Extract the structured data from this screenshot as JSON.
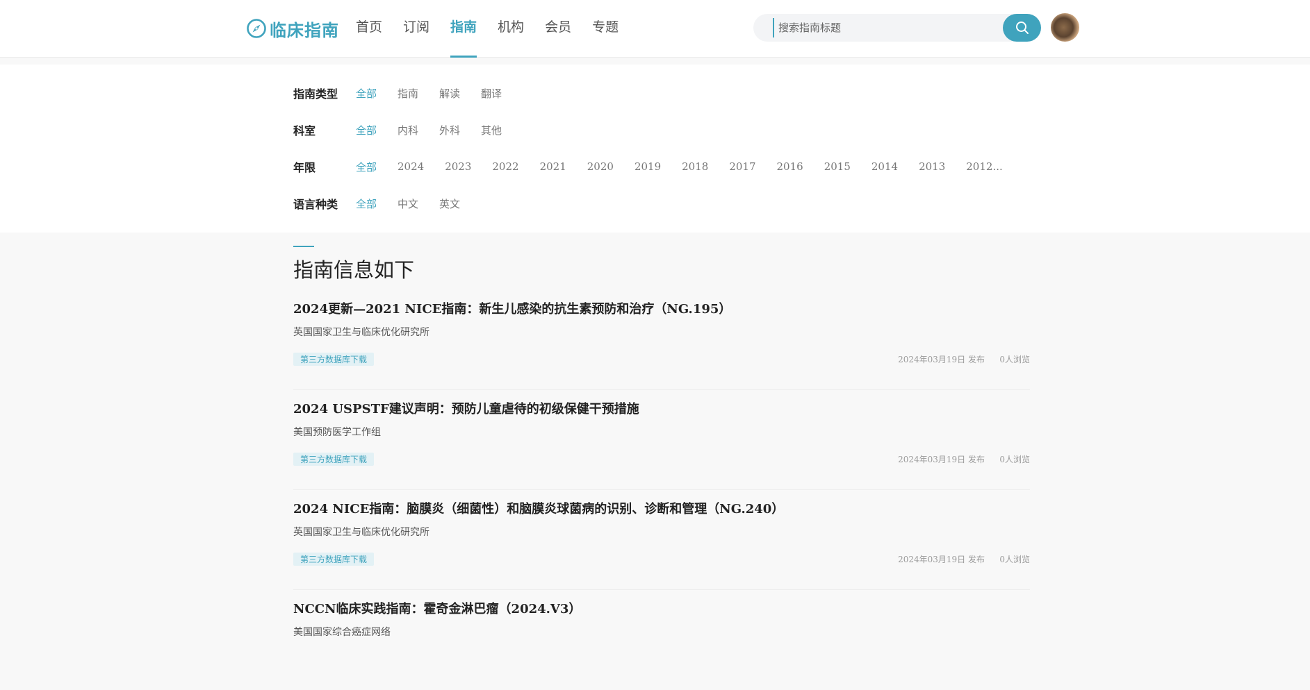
{
  "header": {
    "logo_text": "临床指南",
    "nav": [
      {
        "label": "首页",
        "active": false
      },
      {
        "label": "订阅",
        "active": false
      },
      {
        "label": "指南",
        "active": true
      },
      {
        "label": "机构",
        "active": false
      },
      {
        "label": "会员",
        "active": false
      },
      {
        "label": "专题",
        "active": false
      }
    ],
    "search": {
      "placeholder": "搜索指南标题"
    },
    "accent_color": "#3fa3bd"
  },
  "filters": [
    {
      "label": "指南类型",
      "options": [
        "全部",
        "指南",
        "解读",
        "翻译"
      ],
      "active": 0
    },
    {
      "label": "科室",
      "options": [
        "全部",
        "内科",
        "外科",
        "其他"
      ],
      "active": 0
    },
    {
      "label": "年限",
      "options": [
        "全部",
        "2024",
        "2023",
        "2022",
        "2021",
        "2020",
        "2019",
        "2018",
        "2017",
        "2016",
        "2015",
        "2014",
        "2013",
        "2012..."
      ],
      "active": 0
    },
    {
      "label": "语言种类",
      "options": [
        "全部",
        "中文",
        "英文"
      ],
      "active": 0
    }
  ],
  "list": {
    "title": "指南信息如下",
    "items": [
      {
        "title": "2024更新—2021 NICE指南：新生儿感染的抗生素预防和治疗（NG.195）",
        "org": "英国国家卫生与临床优化研究所",
        "tag": "第三方数据库下载",
        "date": "2024年03月19日 发布",
        "views": "0人浏览"
      },
      {
        "title": "2024 USPSTF建议声明：预防儿童虐待的初级保健干预措施",
        "org": "美国预防医学工作组",
        "tag": "第三方数据库下载",
        "date": "2024年03月19日 发布",
        "views": "0人浏览"
      },
      {
        "title": "2024 NICE指南：脑膜炎（细菌性）和脑膜炎球菌病的识别、诊断和管理（NG.240）",
        "org": "英国国家卫生与临床优化研究所",
        "tag": "第三方数据库下载",
        "date": "2024年03月19日 发布",
        "views": "0人浏览"
      },
      {
        "title": "NCCN临床实践指南：霍奇金淋巴瘤（2024.V3）",
        "org": "美国国家综合癌症网络",
        "tag": "",
        "date": "",
        "views": ""
      }
    ]
  }
}
